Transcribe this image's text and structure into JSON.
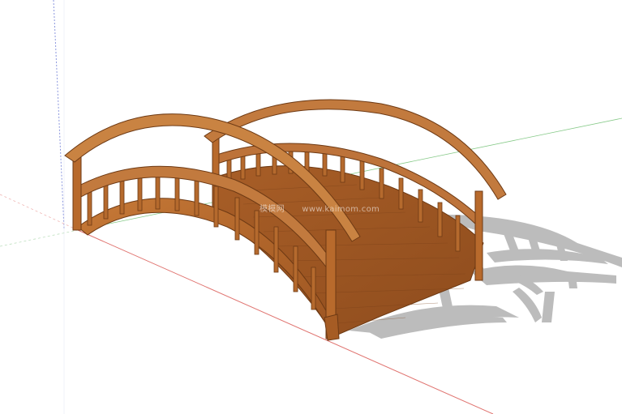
{
  "watermark": {
    "brand": "模模网",
    "url": "www.kaimom.com"
  },
  "colors": {
    "background": "#ffffff",
    "wood": "#b86a2c",
    "wood_dark": "#8a4a1c",
    "wood_light": "#d08a48",
    "shadow": "#bdbdbd",
    "axis_red": "#d9534f",
    "axis_green": "#4caf50",
    "axis_blue": "#3f51b5"
  },
  "scene": {
    "model": "arched-wooden-footbridge",
    "axes_visible": true,
    "shadows_visible": true
  }
}
